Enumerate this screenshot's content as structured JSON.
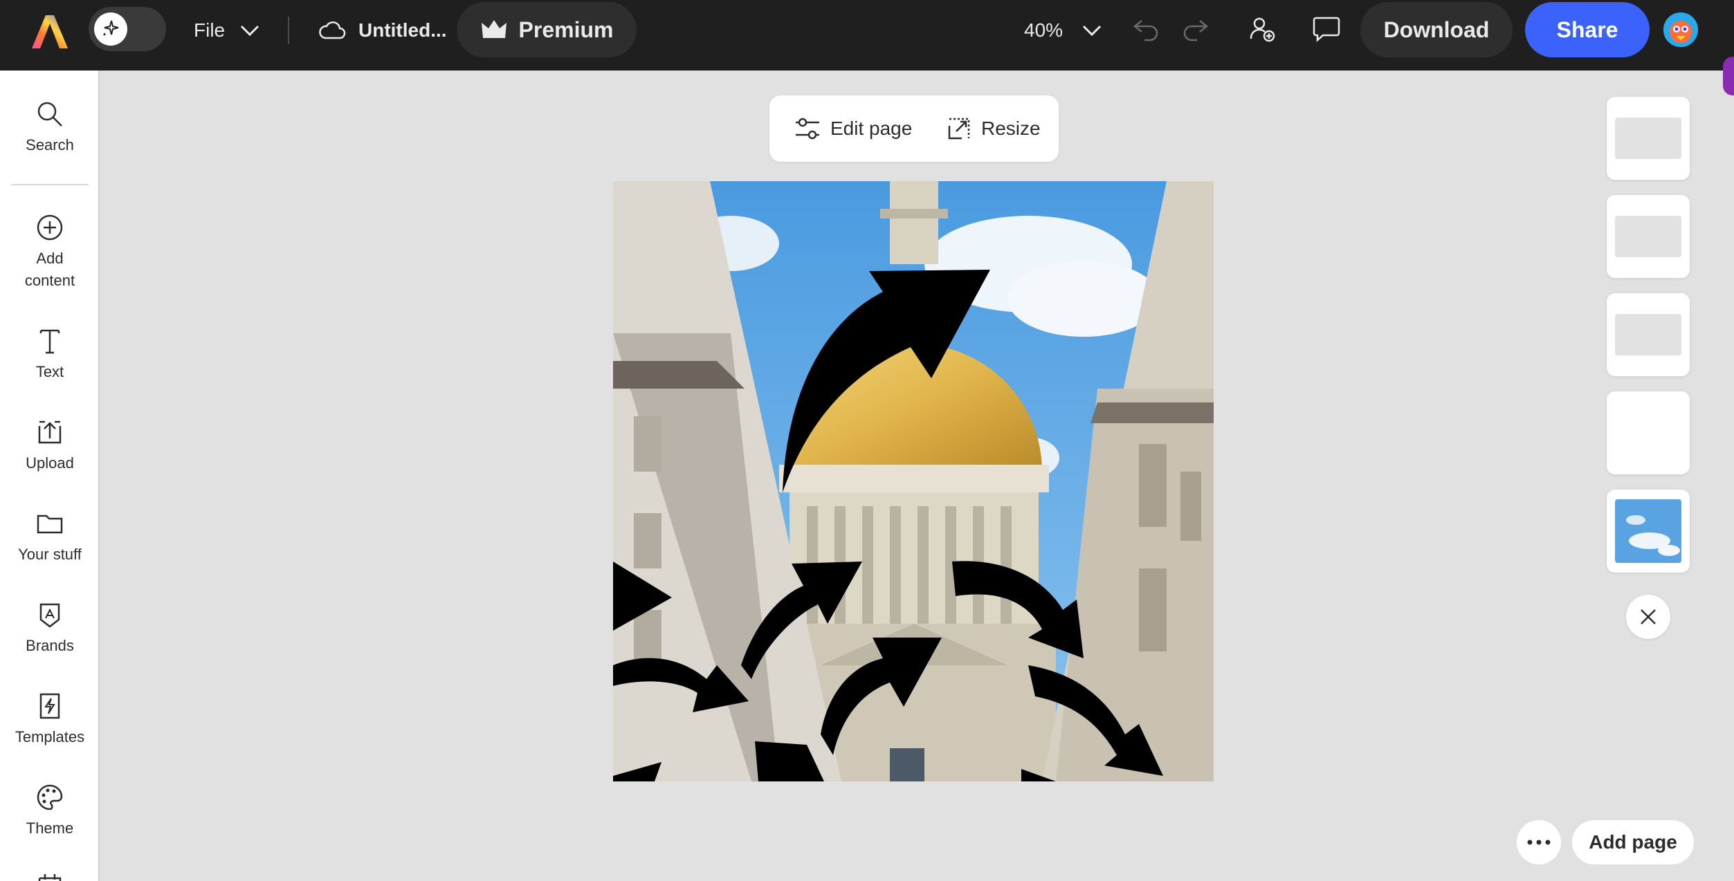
{
  "topbar": {
    "file_label": "File",
    "doc_title": "Untitled...",
    "premium_label": "Premium",
    "zoom_level": "40%",
    "download_label": "Download",
    "share_label": "Share"
  },
  "sidebar": {
    "items": [
      {
        "label": "Search"
      },
      {
        "label": "Add\ncontent"
      },
      {
        "label": "Text"
      },
      {
        "label": "Upload"
      },
      {
        "label": "Your stuff"
      },
      {
        "label": "Brands"
      },
      {
        "label": "Templates"
      },
      {
        "label": "Theme"
      }
    ]
  },
  "canvas": {
    "edit_page_label": "Edit page",
    "resize_label": "Resize"
  },
  "footer": {
    "add_page_label": "Add page"
  },
  "colors": {
    "topbar_bg": "#1f1f1f",
    "accent_blue": "#3b63fb",
    "canvas_bg": "#e1e1e1"
  }
}
